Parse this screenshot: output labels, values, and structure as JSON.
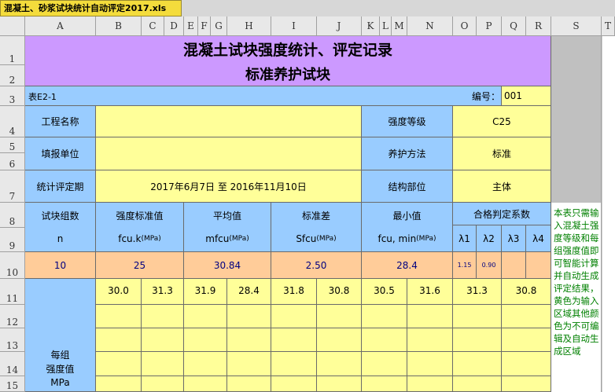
{
  "window": {
    "tab_title": "混凝土、砂浆试块统计自动评定2017.xls"
  },
  "columns": [
    "A",
    "B",
    "C",
    "D",
    "E",
    "F",
    "G",
    "H",
    "I",
    "J",
    "K",
    "L",
    "M",
    "N",
    "O",
    "P",
    "Q",
    "R",
    "S",
    "T"
  ],
  "rows": [
    "1",
    "2",
    "3",
    "4",
    "5",
    "6",
    "7",
    "8",
    "9",
    "10",
    "11",
    "12",
    "13",
    "14",
    "15"
  ],
  "sheet": {
    "title1": "混凝土试块强度统计、评定记录",
    "title2": "标准养护试块",
    "form_code": "表E2-1",
    "number_label": "编号：",
    "number_value": "001",
    "project_label": "工程名称",
    "project_value": "",
    "grade_label": "强度等级",
    "grade_value": "C25",
    "unit_label": "填报单位",
    "unit_value": "",
    "curing_label": "养护方法",
    "curing_value": "标准",
    "period_label": "统计评定期",
    "period_value": "2017年6月7日 至 2016年11月10日",
    "part_label": "结构部位",
    "part_value": "主体",
    "group_count_label": "试块组数",
    "group_count_sym": "n",
    "std_strength_label": "强度标准值",
    "std_strength_sym": "fcu.k",
    "std_strength_unit": "(MPa)",
    "mean_label": "平均值",
    "mean_sym": "mfcu",
    "mean_unit": "(MPa)",
    "stdev_label": "标准差",
    "stdev_sym": "Sfcu",
    "stdev_unit": "(MPa)",
    "min_label": "最小值",
    "min_sym": "fcu, min",
    "min_unit": "(MPa)",
    "coef_label": "合格判定系数",
    "lambda1": "λ1",
    "lambda2": "λ2",
    "lambda3": "λ3",
    "lambda4": "λ4",
    "values": {
      "n": "10",
      "fcuk": "25",
      "mean": "30.84",
      "stdev": "2.50",
      "min": "28.4",
      "l1": "1.15",
      "l2": "0.90",
      "l3": "",
      "l4": ""
    },
    "strength_label_1": "每组",
    "strength_label_2": "强度值",
    "strength_label_3": "MPa",
    "strengths": [
      "30.0",
      "31.3",
      "31.9",
      "28.4",
      "31.8",
      "30.8",
      "30.5",
      "31.6",
      "31.3",
      "30.8"
    ],
    "note": "本表只需输入混凝土强度等级和每组强度值即可智能计算并自动生成评定结果，黄色为输入区域其他颜色为不可编辑及自动生成区域"
  }
}
